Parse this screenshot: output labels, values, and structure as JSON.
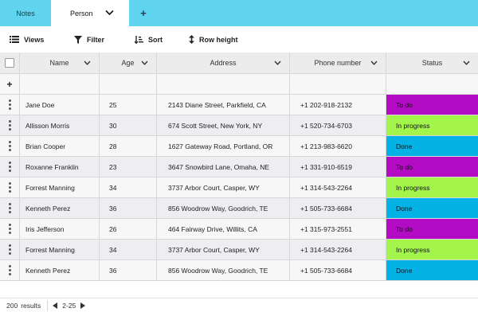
{
  "tabs": [
    {
      "label": "Notes"
    },
    {
      "label": "Person"
    }
  ],
  "add_tab": "+",
  "toolbar": {
    "views_label": "Views",
    "filter_label": "Filter",
    "sort_label": "Sort",
    "rowheight_label": "Row height"
  },
  "columns": {
    "name": "Name",
    "age": "Age",
    "address": "Address",
    "phone": "Phone number",
    "status": "Status"
  },
  "add_row_label": "+",
  "status_colors": {
    "To do": "#b30ac3",
    "In progress": "#a3f54c",
    "Done": "#05b2e6"
  },
  "rows": [
    {
      "name": "Jane Doe",
      "age": "25",
      "address": "2143 Diane Street, Parkfield, CA",
      "phone": "+1 202-918-2132",
      "status": "To do"
    },
    {
      "name": "Allisson Morris",
      "age": "30",
      "address": "674 Scott Street, New York, NY",
      "phone": "+1 520-734-6703",
      "status": "In progress"
    },
    {
      "name": "Brian Cooper",
      "age": "28",
      "address": "1627 Gateway Road, Portland, OR",
      "phone": "+1 213-983-6620",
      "status": "Done"
    },
    {
      "name": "Roxanne Franklin",
      "age": "23",
      "address": "3647 Snowbird Lane, Omaha, NE",
      "phone": "+1 331-910-6519",
      "status": "To do"
    },
    {
      "name": "Forrest Manning",
      "age": "34",
      "address": "3737 Arbor Court, Casper, WY",
      "phone": "+1 314-543-2264",
      "status": "In progress"
    },
    {
      "name": "Kenneth Perez",
      "age": "36",
      "address": "856 Woodrow Way, Goodrich, TE",
      "phone": "+1 505-733-6684",
      "status": "Done"
    },
    {
      "name": "Iris Jefferson",
      "age": "26",
      "address": "464 Fairway Drive, Willits, CA",
      "phone": "+1 315-973-2551",
      "status": "To do"
    },
    {
      "name": "Forrest Manning",
      "age": "34",
      "address": "3737 Arbor Court, Casper, WY",
      "phone": "+1 314-543-2264",
      "status": "In progress"
    },
    {
      "name": "Kenneth Perez",
      "age": "36",
      "address": "856 Woodrow Way, Goodrich, TE",
      "phone": "+1 505-733-6684",
      "status": "Done"
    }
  ],
  "footer": {
    "count": "200",
    "results_label": "results",
    "range": "2-25"
  },
  "icons": {
    "tab_dropdown": "chevron-down-icon",
    "views": "list-icon",
    "filter": "funnel-icon",
    "sort": "sort-icon",
    "rowheight": "updown-arrows-icon",
    "drag": "drag-handle-icon",
    "prev": "triangle-left-icon",
    "next": "triangle-right-icon"
  }
}
